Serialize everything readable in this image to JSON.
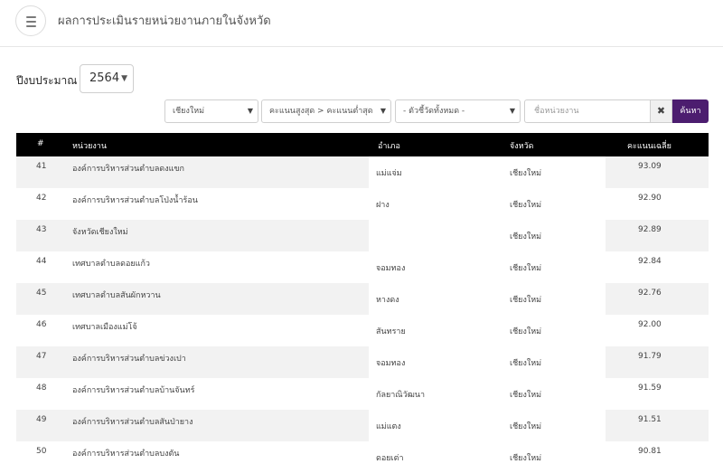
{
  "header": {
    "title": "ผลการประเมินรายหน่วยงานภายในจังหวัด"
  },
  "filters": {
    "fiscal_year_label": "ปีงบประมาณ",
    "fiscal_year": "2564",
    "province": "เชียงใหม่",
    "sort": "คะแนนสูงสุด > คะแนนต่ำสุด",
    "indicator": "- ตัวชี้วัดทั้งหมด -",
    "search_placeholder": "ชื่อหน่วยงาน",
    "clear_label": "✖",
    "search_label": "ค้นหา"
  },
  "table": {
    "columns": [
      "#",
      "หน่วยงาน",
      "อำเภอ",
      "จังหวัด",
      "คะแนนเฉลี่ย"
    ],
    "rows": [
      {
        "num": "41",
        "unit": "องค์การบริหารส่วนตำบลดงแขก",
        "district": "แม่แจ่ม",
        "province": "เชียงใหม่",
        "score": "93.09"
      },
      {
        "num": "42",
        "unit": "องค์การบริหารส่วนตำบลโป่งน้ำร้อน",
        "district": "ฝาง",
        "province": "เชียงใหม่",
        "score": "92.90"
      },
      {
        "num": "43",
        "unit": "จังหวัดเชียงใหม่",
        "district": "",
        "province": "เชียงใหม่",
        "score": "92.89"
      },
      {
        "num": "44",
        "unit": "เทศบาลตำบลดอยแก้ว",
        "district": "จอมทอง",
        "province": "เชียงใหม่",
        "score": "92.84"
      },
      {
        "num": "45",
        "unit": "เทศบาลตำบลสันผักหวาน",
        "district": "หางดง",
        "province": "เชียงใหม่",
        "score": "92.76"
      },
      {
        "num": "46",
        "unit": "เทศบาลเมืองแม่โจ้",
        "district": "สันทราย",
        "province": "เชียงใหม่",
        "score": "92.00"
      },
      {
        "num": "47",
        "unit": "องค์การบริหารส่วนตำบลข่วงเปา",
        "district": "จอมทอง",
        "province": "เชียงใหม่",
        "score": "91.79"
      },
      {
        "num": "48",
        "unit": "องค์การบริหารส่วนตำบลบ้านจันทร์",
        "district": "กัลยาณิวัฒนา",
        "province": "เชียงใหม่",
        "score": "91.59"
      },
      {
        "num": "49",
        "unit": "องค์การบริหารส่วนตำบลสันป่ายาง",
        "district": "แม่แตง",
        "province": "เชียงใหม่",
        "score": "91.51"
      },
      {
        "num": "50",
        "unit": "องค์การบริหารส่วนตำบลบงตัน",
        "district": "ดอยเต่า",
        "province": "เชียงใหม่",
        "score": "90.81"
      }
    ]
  },
  "colors": {
    "accent": "#4c1d6f",
    "header_bg": "#000000",
    "stripe": "#f2f2f2"
  },
  "icons": {
    "menu": "hamburger-menu-icon",
    "dropdown": "chevron-down-icon",
    "clear": "close-icon"
  }
}
